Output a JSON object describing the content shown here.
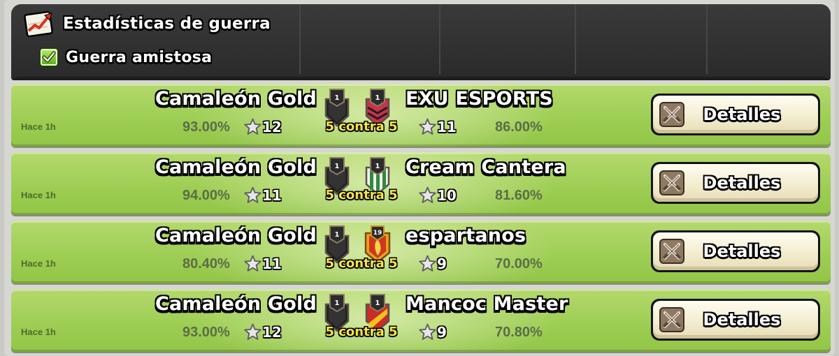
{
  "header": {
    "title": "Estadísticas de guerra",
    "filter_label": "Guerra amistosa",
    "filter_checked": true
  },
  "wars": [
    {
      "time": "Hace 1h",
      "clan": "Camaleón Gold",
      "clan_pct": "93.00%",
      "clan_stars": "12",
      "clan_badge_level": "1",
      "versus": "5 contra 5",
      "opponent": "EXU ESPORTS",
      "opponent_pct": "86.00%",
      "opponent_stars": "11",
      "opponent_badge_level": "1",
      "opponent_badge": "red-chevron-shield",
      "details_label": "Detalles"
    },
    {
      "time": "Hace 1h",
      "clan": "Camaleón Gold",
      "clan_pct": "94.00%",
      "clan_stars": "11",
      "clan_badge_level": "1",
      "versus": "5 contra 5",
      "opponent": "Cream Cantera",
      "opponent_pct": "81.60%",
      "opponent_stars": "10",
      "opponent_badge_level": "1",
      "opponent_badge": "green-striped-shield",
      "details_label": "Detalles"
    },
    {
      "time": "Hace 1h",
      "clan": "Camaleón Gold",
      "clan_pct": "80.40%",
      "clan_stars": "11",
      "clan_badge_level": "1",
      "versus": "5 contra 5",
      "opponent": "espartanos",
      "opponent_pct": "70.00%",
      "opponent_stars": "9",
      "opponent_badge_level": "19",
      "opponent_badge": "gold-flame-shield",
      "details_label": "Detalles"
    },
    {
      "time": "Hace 1h",
      "clan": "Camaleón Gold",
      "clan_pct": "93.00%",
      "clan_stars": "12",
      "clan_badge_level": "1",
      "versus": "5 contra 5",
      "opponent": "Mancoc Master",
      "opponent_pct": "70.80%",
      "opponent_stars": "9",
      "opponent_badge_level": "1",
      "opponent_badge": "red-yellow-diagonal-shield",
      "details_label": "Detalles"
    }
  ],
  "colors": {
    "row_green": "#a3d15a",
    "header_dark": "#333333",
    "versus_yellow": "#f7e34a",
    "percent_text": "#5b6d46"
  }
}
